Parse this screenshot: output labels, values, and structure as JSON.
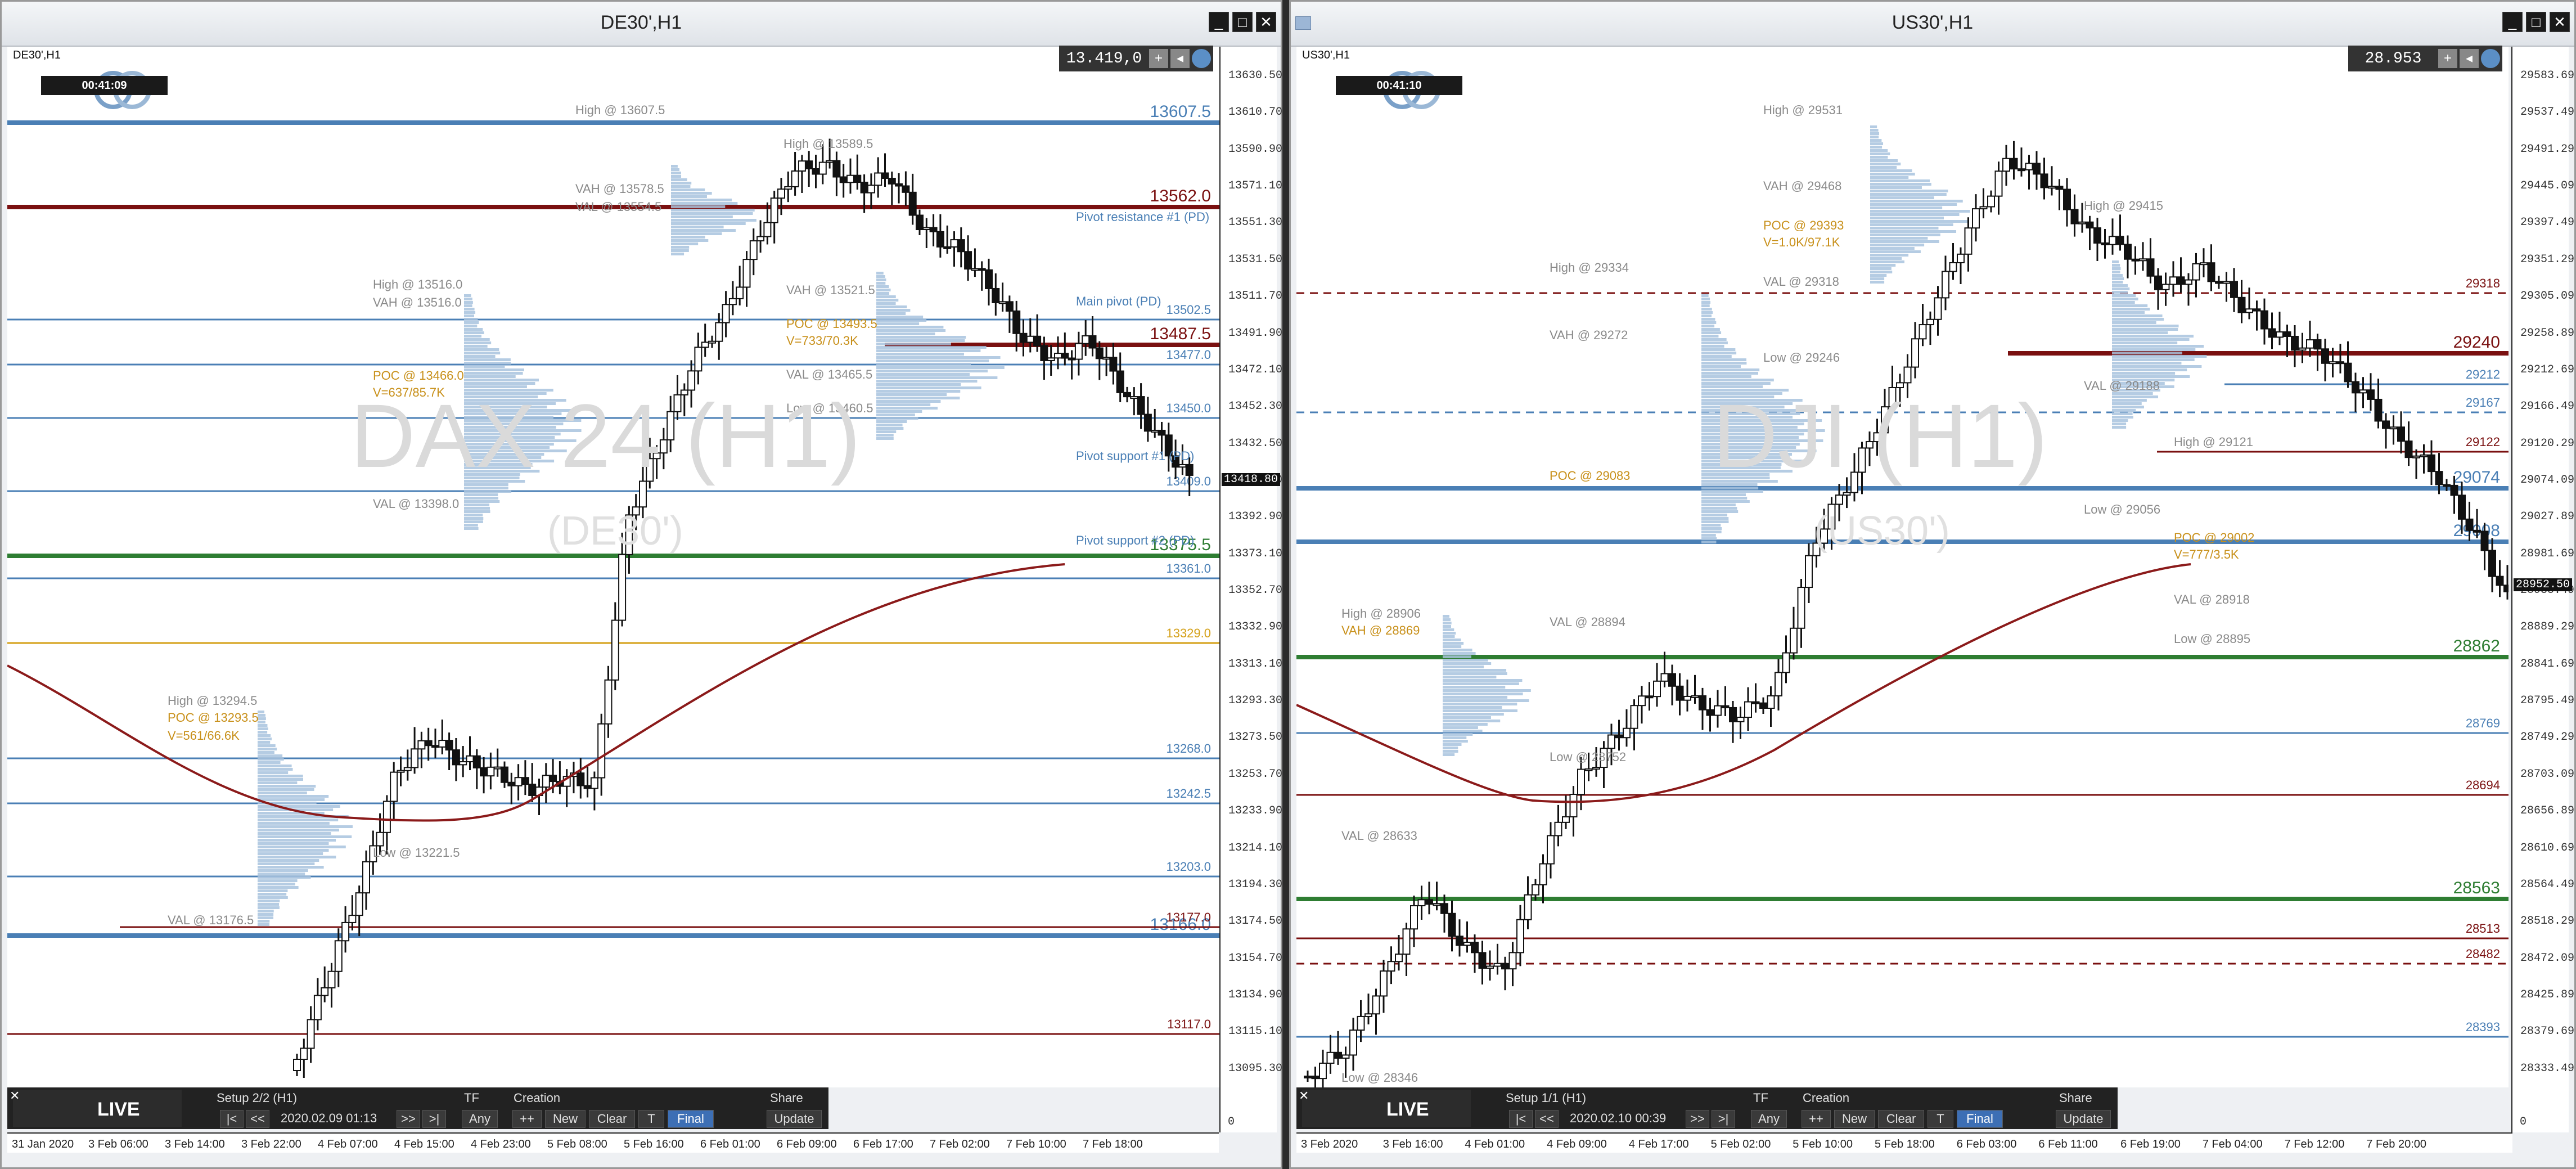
{
  "left": {
    "title": "DE30',H1",
    "symbol_label": "DE30',H1",
    "timer": "00:41:09",
    "price": "13.419,0",
    "watermark": "DAX 24 (H1)",
    "watermark_sub": "(DE30')",
    "price_axis": [
      "13630.50",
      "13610.70",
      "13590.90",
      "13571.10",
      "13551.30",
      "13531.50",
      "13511.70",
      "13491.90",
      "13472.10",
      "13452.30",
      "13432.50",
      "13412.70",
      "13392.90",
      "13373.10",
      "13352.70",
      "13332.90",
      "13313.10",
      "13293.30",
      "13273.50",
      "13253.70",
      "13233.90",
      "13214.10",
      "13194.30",
      "13174.50",
      "13154.70",
      "13134.90",
      "13115.10",
      "13095.30"
    ],
    "current_price_tag": "13418.80",
    "time_axis": [
      "31 Jan 2020",
      "3 Feb 06:00",
      "3 Feb 14:00",
      "3 Feb 22:00",
      "4 Feb 07:00",
      "4 Feb 15:00",
      "4 Feb 23:00",
      "5 Feb 08:00",
      "5 Feb 16:00",
      "6 Feb 01:00",
      "6 Feb 09:00",
      "6 Feb 17:00",
      "7 Feb 02:00",
      "7 Feb 10:00",
      "7 Feb 18:00"
    ],
    "levels": [
      {
        "label": "13607.5",
        "color": "#4a7fb5"
      },
      {
        "label": "13562.0",
        "color": "#7a1010"
      },
      {
        "label": "13502.5",
        "color": "#4a7fb5"
      },
      {
        "label": "13487.5",
        "color": "#7a1010"
      },
      {
        "label": "13477.0",
        "color": "#4a7fb5"
      },
      {
        "label": "13450.0",
        "color": "#4a7fb5"
      },
      {
        "label": "13409.0",
        "color": "#4a7fb5"
      },
      {
        "label": "13375.5",
        "color": "#2e7d32"
      },
      {
        "label": "13361.0",
        "color": "#4a7fb5"
      },
      {
        "label": "13329.0",
        "color": "#d4a017"
      },
      {
        "label": "13268.0",
        "color": "#4a7fb5"
      },
      {
        "label": "13242.5",
        "color": "#4a7fb5"
      },
      {
        "label": "13203.0",
        "color": "#4a7fb5"
      },
      {
        "label": "13166.0",
        "color": "#4a7fb5"
      },
      {
        "label": "13177.0",
        "color": "#7a1010"
      },
      {
        "label": "13117.0",
        "color": "#7a1010"
      }
    ],
    "annotations": {
      "high1": "High @ 13607.5",
      "high2": "High @ 13589.5",
      "vah1": "VAH @ 13578.5",
      "val1": "VAL @ 13554.5",
      "pivot_r1": "Pivot resistance #1 (PD)",
      "main_pivot": "Main pivot (PD)",
      "pivot_s1": "Pivot support #1 (PD)",
      "pivot_s2": "Pivot support #2 (PD)",
      "high3": "High @ 13516.0",
      "vah3": "VAH @ 13516.0",
      "vah2": "VAH @ 13521.5",
      "poc2": "POC @ 13493.5",
      "poc2v": "V=733/70.3K",
      "val2": "VAL @ 13465.5",
      "low2": "Low @ 13460.5",
      "poc3": "POC @ 13466.0",
      "poc3v": "V=637/85.7K",
      "val3": "VAL @ 13398.0",
      "high4": "High @ 13294.5",
      "poc4": "POC @ 13293.5",
      "poc4v": "V=561/66.6K",
      "low4": "Low @ 13221.5",
      "val4": "VAL @ 13176.5"
    },
    "panel": {
      "setup": "Setup 2/2 (H1)",
      "date": "2020.02.09 01:13",
      "tf_label": "TF",
      "tf_value": "Any",
      "creation_label": "Creation",
      "share_label": "Share",
      "btn_first": "|<",
      "btn_prev": "<<",
      "btn_next": ">>",
      "btn_last": ">|",
      "btn_plus": "++",
      "btn_new": "New",
      "btn_clear": "Clear",
      "btn_t": "T",
      "btn_final": "Final",
      "btn_update": "Update",
      "live": "LIVE",
      "axis_zero": "0"
    }
  },
  "right": {
    "title": "US30',H1",
    "symbol_label": "US30',H1",
    "timer": "00:41:10",
    "price": "28.953",
    "watermark": "DJI (H1)",
    "watermark_sub": "(US30')",
    "price_axis": [
      "29583.69",
      "29537.49",
      "29491.29",
      "29445.09",
      "29397.49",
      "29351.29",
      "29305.09",
      "29258.89",
      "29212.69",
      "29166.49",
      "29120.29",
      "29074.09",
      "29027.89",
      "28981.69",
      "28935.49",
      "28889.29",
      "28841.69",
      "28795.49",
      "28749.29",
      "28703.09",
      "28656.89",
      "28610.69",
      "28564.49",
      "28518.29",
      "28472.09",
      "28425.89",
      "28379.69",
      "28333.49"
    ],
    "current_price_tag": "28952.50",
    "time_axis": [
      "3 Feb 2020",
      "3 Feb 16:00",
      "4 Feb 01:00",
      "4 Feb 09:00",
      "4 Feb 17:00",
      "5 Feb 02:00",
      "5 Feb 10:00",
      "5 Feb 18:00",
      "6 Feb 03:00",
      "6 Feb 11:00",
      "6 Feb 19:00",
      "7 Feb 04:00",
      "7 Feb 12:00",
      "7 Feb 20:00"
    ],
    "levels": [
      {
        "label": "29318",
        "color": "#7a1010"
      },
      {
        "label": "29240",
        "color": "#7a1010"
      },
      {
        "label": "29212",
        "color": "#4a7fb5"
      },
      {
        "label": "29167",
        "color": "#4a7fb5"
      },
      {
        "label": "29122",
        "color": "#7a1010"
      },
      {
        "label": "29074",
        "color": "#4a7fb5"
      },
      {
        "label": "29008",
        "color": "#4a7fb5"
      },
      {
        "label": "28862",
        "color": "#2e7d32"
      },
      {
        "label": "28769",
        "color": "#4a7fb5"
      },
      {
        "label": "28694",
        "color": "#7a1010"
      },
      {
        "label": "28563",
        "color": "#2e7d32"
      },
      {
        "label": "28513",
        "color": "#7a1010"
      },
      {
        "label": "28482",
        "color": "#7a1010"
      },
      {
        "label": "28393",
        "color": "#4a7fb5"
      }
    ],
    "annotations": {
      "high1": "High @ 29531",
      "vah1": "VAH @ 29468",
      "poc1": "POC @ 29393",
      "poc1v": "V=1.0K/97.1K",
      "val1": "VAL @ 29318",
      "high2": "High @ 29334",
      "vah2": "VAH @ 29272",
      "low2": "Low @ 29246",
      "high3": "High @ 29415",
      "val3": "VAL @ 29188",
      "poc3": "POC @ 29083",
      "low3": "Low @ 29056",
      "high4": "High @ 29121",
      "poc4": "POC @ 29002",
      "poc4v": "V=777/3.5K",
      "val4": "VAL @ 28918",
      "low4": "Low @ 28895",
      "high5": "High @ 28906",
      "vah5": "VAH @ 28869",
      "val5": "VAL @ 28894",
      "low5": "Low @ 28752",
      "val6": "VAL @ 28633",
      "low6": "Low @ 28346"
    },
    "panel": {
      "setup": "Setup 1/1 (H1)",
      "date": "2020.02.10 00:39",
      "tf_label": "TF",
      "tf_value": "Any",
      "creation_label": "Creation",
      "share_label": "Share",
      "btn_first": "|<",
      "btn_prev": "<<",
      "btn_next": ">>",
      "btn_last": ">|",
      "btn_plus": "++",
      "btn_new": "New",
      "btn_clear": "Clear",
      "btn_t": "T",
      "btn_final": "Final",
      "btn_update": "Update",
      "live": "LIVE",
      "axis_zero": "0"
    }
  },
  "window_buttons": {
    "minimize": "_",
    "maximize": "□",
    "close": "✕"
  },
  "icons": [
    "minimize-icon",
    "maximize-icon",
    "close-icon",
    "plus-icon",
    "arrow-left-icon",
    "globe-icon",
    "logo-icon"
  ]
}
